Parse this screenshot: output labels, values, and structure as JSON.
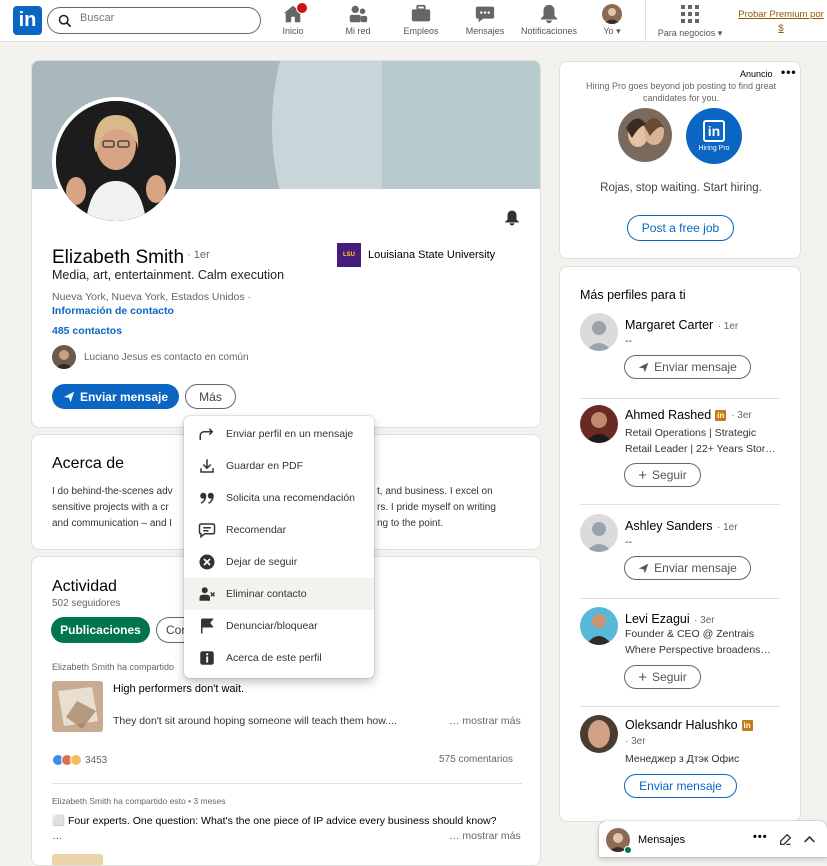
{
  "nav": {
    "search_placeholder": "Buscar",
    "items": [
      {
        "label": "Inicio",
        "icon": "home-icon"
      },
      {
        "label": "Mi red",
        "icon": "people-icon"
      },
      {
        "label": "Empleos",
        "icon": "briefcase-icon"
      },
      {
        "label": "Mensajes",
        "icon": "chat-icon"
      },
      {
        "label": "Notificaciones",
        "icon": "bell-icon"
      },
      {
        "label": "Yo",
        "icon": "avatar"
      },
      {
        "label": "Para negocios",
        "icon": "grid-icon"
      }
    ],
    "premium_line1": "Probar Premium por",
    "premium_line2": "$",
    "brand_color": "#0a66c2"
  },
  "profile": {
    "name": "Elizabeth Smith",
    "degree": "· 1er",
    "headline": "Media, art, entertainment. Calm execution",
    "location": "Nueva York, Nueva York, Estados Unidos ·",
    "contact_info": "Información de contacto",
    "connections": "485 contactos",
    "mutual": "Luciano Jesus es contacto en común",
    "school": "Louisiana State University",
    "school_logo": "LSU",
    "message_btn": "Enviar mensaje",
    "more_btn": "Más"
  },
  "menu": [
    {
      "label": "Enviar perfil en un mensaje",
      "icon": "share-icon"
    },
    {
      "label": "Guardar en PDF",
      "icon": "download-icon"
    },
    {
      "label": "Solicita una recomendación",
      "icon": "quote-icon"
    },
    {
      "label": "Recomendar",
      "icon": "comment-icon"
    },
    {
      "label": "Dejar de seguir",
      "icon": "x-circle-icon"
    },
    {
      "label": "Eliminar contacto",
      "icon": "remove-person-icon"
    },
    {
      "label": "Denunciar/bloquear",
      "icon": "flag-icon"
    },
    {
      "label": "Acerca de este perfil",
      "icon": "info-icon"
    }
  ],
  "about": {
    "title": "Acerca de",
    "line1a": "I do behind-the-scenes adv",
    "line1b": "t, and business. I excel on",
    "line2a": "sensitive projects with a cr",
    "line2b": "rs. I pride myself on writing",
    "line3a": "and communication – and I",
    "line3b": "ng to the point."
  },
  "activity": {
    "title": "Actividad",
    "followers": "502 seguidores",
    "tab_posts": "Publicaciones",
    "tab_comments": "Cor",
    "post1_header": "Elizabeth Smith ha compartido",
    "post1_title": "High performers don't wait.",
    "post1_text": "They don't sit around hoping someone will teach them how....",
    "post1_more": "… mostrar más",
    "reactions": "3453",
    "comments": "575 comentarios",
    "post2_header": "Elizabeth Smith ha compartido esto • 3 meses",
    "post2_text": "⬜ Four experts. One question: What's the one piece of IP advice every business should know?",
    "post2_ellipsis": "…",
    "post2_more": "… mostrar más"
  },
  "ad": {
    "label": "Anuncio",
    "tagline1": "Hiring Pro goes beyond job posting to find great",
    "tagline2": "candidates for you.",
    "badge": "Hiring Pro",
    "message": "Rojas, stop waiting. Start hiring.",
    "cta": "Post a free job"
  },
  "suggestions": {
    "title": "Más perfiles para ti",
    "people": [
      {
        "name": "Margaret Carter",
        "degree": "· 1er",
        "line1": "--",
        "line2": "",
        "action": "Enviar mensaje"
      },
      {
        "name": "Ahmed Rashed",
        "degree": "· 3er",
        "line1": "Retail Operations | Strategic",
        "line2": "Retail Leader | 22+ Years Stor…",
        "action": "Seguir"
      },
      {
        "name": "Ashley Sanders",
        "degree": "· 1er",
        "line1": "--",
        "line2": "",
        "action": "Enviar mensaje"
      },
      {
        "name": "Levi Ezagui",
        "degree": "· 3er",
        "line1": "Founder & CEO @ Zentrais",
        "line2": "Where Perspective broadens…",
        "action": "Seguir"
      },
      {
        "name": "Oleksandr Halushko",
        "degree": "· 3er",
        "line1": "Менеджер з Дтэк Офис",
        "line2": "",
        "action": "Enviar mensaje"
      }
    ]
  },
  "messaging": {
    "label": "Mensajes"
  }
}
